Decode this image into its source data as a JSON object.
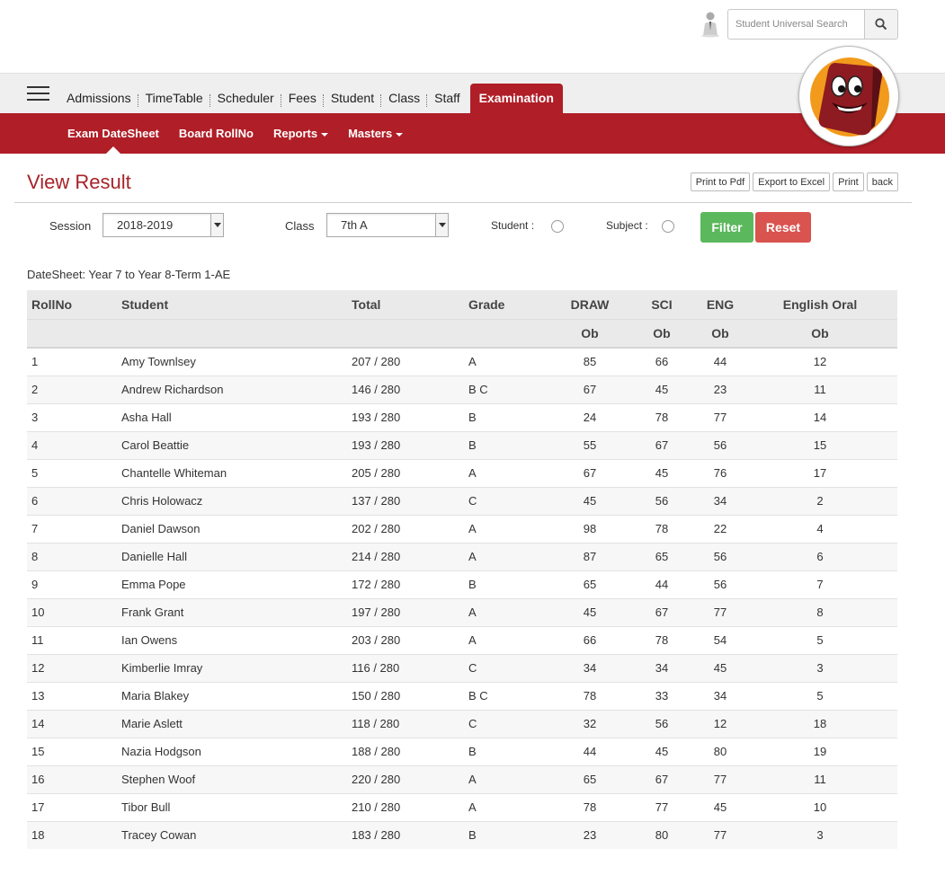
{
  "search": {
    "placeholder": "Student Universal Search"
  },
  "nav": {
    "items": [
      "Admissions",
      "TimeTable",
      "Scheduler",
      "Fees",
      "Student",
      "Class",
      "Staff"
    ],
    "active": "Examination"
  },
  "subnav": {
    "exam_datesheet": "Exam DateSheet",
    "board_rollno": "Board RollNo",
    "reports": "Reports",
    "masters": "Masters"
  },
  "page": {
    "title": "View Result",
    "actions": {
      "pdf": "Print to Pdf",
      "excel": "Export to Excel",
      "print": "Print",
      "back": "back"
    }
  },
  "filters": {
    "session_label": "Session",
    "session_value": "2018-2019",
    "class_label": "Class",
    "class_value": "7th A",
    "student_label": "Student :",
    "subject_label": "Subject :",
    "filter_button": "Filter",
    "reset_button": "Reset"
  },
  "datesheet": "DateSheet: Year 7 to Year 8-Term 1-AE",
  "table": {
    "headers": {
      "rollno": "RollNo",
      "student": "Student",
      "total": "Total",
      "grade": "Grade",
      "draw": "DRAW",
      "sci": "SCI",
      "eng": "ENG",
      "oral": "English Oral"
    },
    "sub_header": "Ob",
    "rows": [
      {
        "roll": "1",
        "name": "Amy Townlsey",
        "total": "207 / 280",
        "grade": "A",
        "draw": "85",
        "sci": "66",
        "eng": "44",
        "oral": "12"
      },
      {
        "roll": "2",
        "name": "Andrew Richardson",
        "total": "146 / 280",
        "grade": "B C",
        "draw": "67",
        "sci": "45",
        "eng": "23",
        "oral": "11"
      },
      {
        "roll": "3",
        "name": "Asha Hall",
        "total": "193 / 280",
        "grade": "B",
        "draw": "24",
        "sci": "78",
        "eng": "77",
        "oral": "14"
      },
      {
        "roll": "4",
        "name": "Carol Beattie",
        "total": "193 / 280",
        "grade": "B",
        "draw": "55",
        "sci": "67",
        "eng": "56",
        "oral": "15"
      },
      {
        "roll": "5",
        "name": "Chantelle Whiteman",
        "total": "205 / 280",
        "grade": "A",
        "draw": "67",
        "sci": "45",
        "eng": "76",
        "oral": "17"
      },
      {
        "roll": "6",
        "name": "Chris Holowacz",
        "total": "137 / 280",
        "grade": "C",
        "draw": "45",
        "sci": "56",
        "eng": "34",
        "oral": "2"
      },
      {
        "roll": "7",
        "name": "Daniel Dawson",
        "total": "202 / 280",
        "grade": "A",
        "draw": "98",
        "sci": "78",
        "eng": "22",
        "oral": "4"
      },
      {
        "roll": "8",
        "name": "Danielle Hall",
        "total": "214 / 280",
        "grade": "A",
        "draw": "87",
        "sci": "65",
        "eng": "56",
        "oral": "6"
      },
      {
        "roll": "9",
        "name": "Emma Pope",
        "total": "172 / 280",
        "grade": "B",
        "draw": "65",
        "sci": "44",
        "eng": "56",
        "oral": "7"
      },
      {
        "roll": "10",
        "name": "Frank Grant",
        "total": "197 / 280",
        "grade": "A",
        "draw": "45",
        "sci": "67",
        "eng": "77",
        "oral": "8"
      },
      {
        "roll": "11",
        "name": "Ian Owens",
        "total": "203 / 280",
        "grade": "A",
        "draw": "66",
        "sci": "78",
        "eng": "54",
        "oral": "5"
      },
      {
        "roll": "12",
        "name": "Kimberlie Imray",
        "total": "116 / 280",
        "grade": "C",
        "draw": "34",
        "sci": "34",
        "eng": "45",
        "oral": "3"
      },
      {
        "roll": "13",
        "name": "Maria Blakey",
        "total": "150 / 280",
        "grade": "B C",
        "draw": "78",
        "sci": "33",
        "eng": "34",
        "oral": "5"
      },
      {
        "roll": "14",
        "name": "Marie Aslett",
        "total": "118 / 280",
        "grade": "C",
        "draw": "32",
        "sci": "56",
        "eng": "12",
        "oral": "18"
      },
      {
        "roll": "15",
        "name": "Nazia Hodgson",
        "total": "188 / 280",
        "grade": "B",
        "draw": "44",
        "sci": "45",
        "eng": "80",
        "oral": "19"
      },
      {
        "roll": "16",
        "name": "Stephen Woof",
        "total": "220 / 280",
        "grade": "A",
        "draw": "65",
        "sci": "67",
        "eng": "77",
        "oral": "11"
      },
      {
        "roll": "17",
        "name": "Tibor Bull",
        "total": "210 / 280",
        "grade": "A",
        "draw": "78",
        "sci": "77",
        "eng": "45",
        "oral": "10"
      },
      {
        "roll": "18",
        "name": "Tracey Cowan",
        "total": "183 / 280",
        "grade": "B",
        "draw": "23",
        "sci": "80",
        "eng": "77",
        "oral": "3"
      }
    ]
  },
  "colors": {
    "brand_red": "#b01e27",
    "title_red": "#a8232a",
    "filter_green": "#5cb85c",
    "reset_red": "#d9534f"
  }
}
